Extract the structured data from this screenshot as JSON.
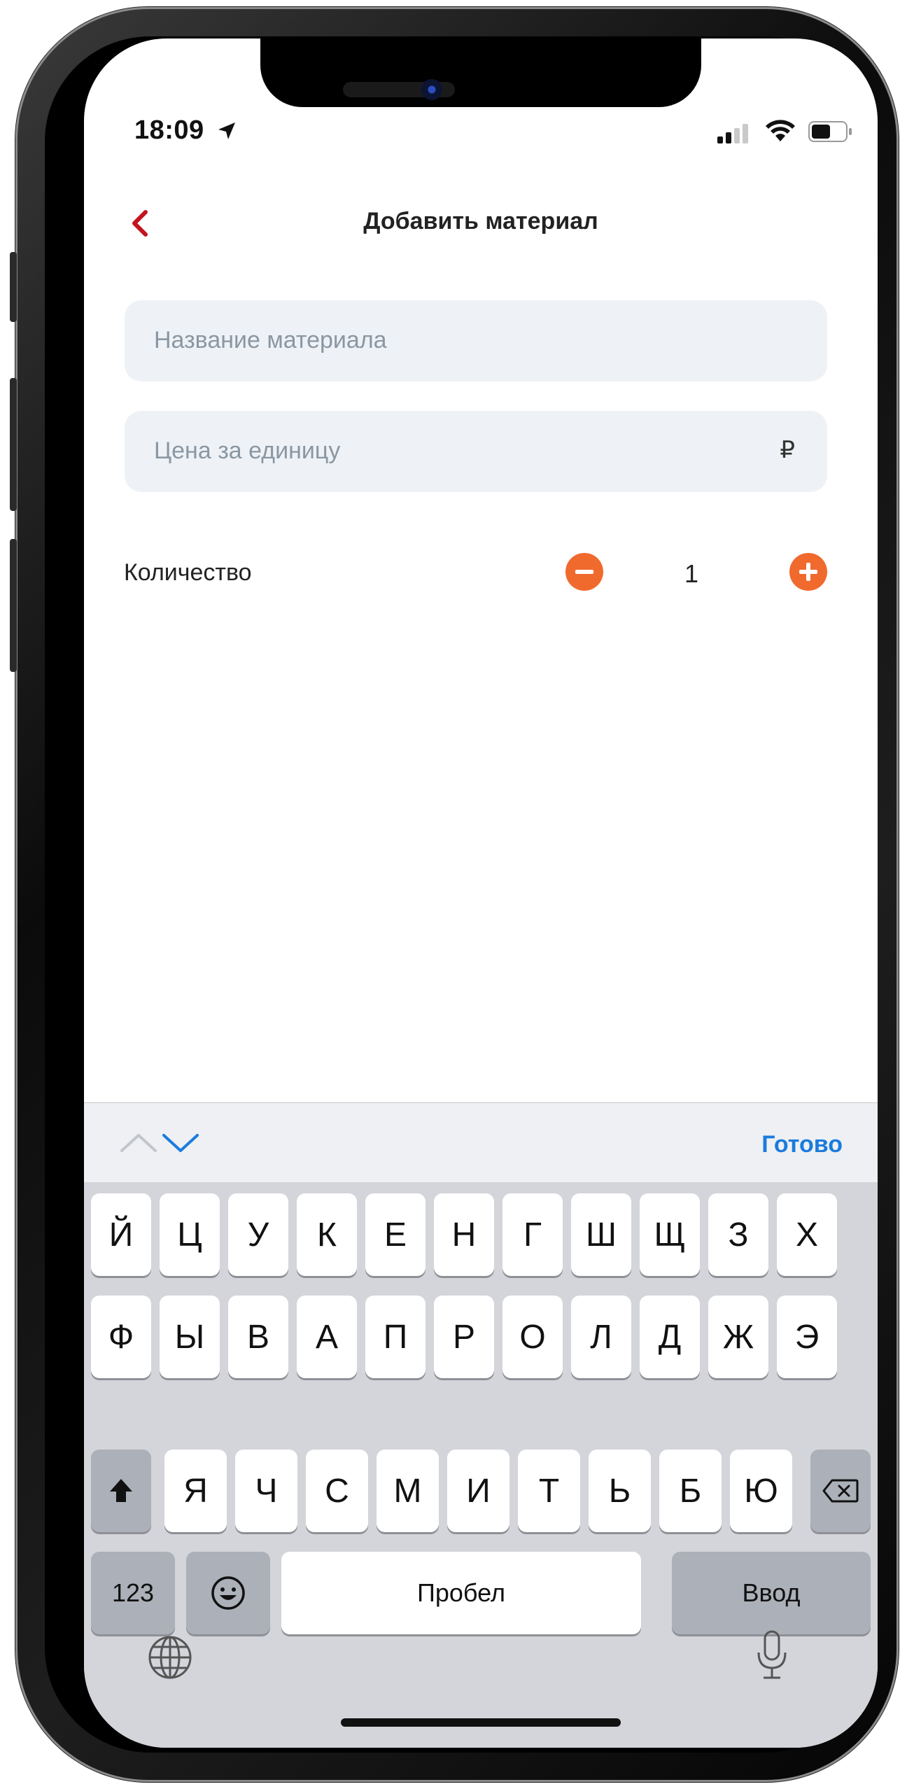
{
  "status": {
    "time": "18:09"
  },
  "header": {
    "title": "Добавить материал"
  },
  "form": {
    "name_placeholder": "Название материала",
    "price_placeholder": "Цена за единицу",
    "currency": "₽",
    "quantity_label": "Количество",
    "quantity_value": "1"
  },
  "keyboard": {
    "done_label": "Готово",
    "row1": [
      "Й",
      "Ц",
      "У",
      "К",
      "Е",
      "Н",
      "Г",
      "Ш",
      "Щ",
      "З",
      "Х"
    ],
    "row2": [
      "Ф",
      "Ы",
      "В",
      "А",
      "П",
      "Р",
      "О",
      "Л",
      "Д",
      "Ж",
      "Э"
    ],
    "row3": [
      "Я",
      "Ч",
      "С",
      "М",
      "И",
      "Т",
      "Ь",
      "Б",
      "Ю"
    ],
    "numbers_label": "123",
    "space_label": "Пробел",
    "return_label": "Ввод"
  },
  "colors": {
    "accent": "#c4141f",
    "stepper": "#f06a2e",
    "link": "#1a7bde"
  }
}
